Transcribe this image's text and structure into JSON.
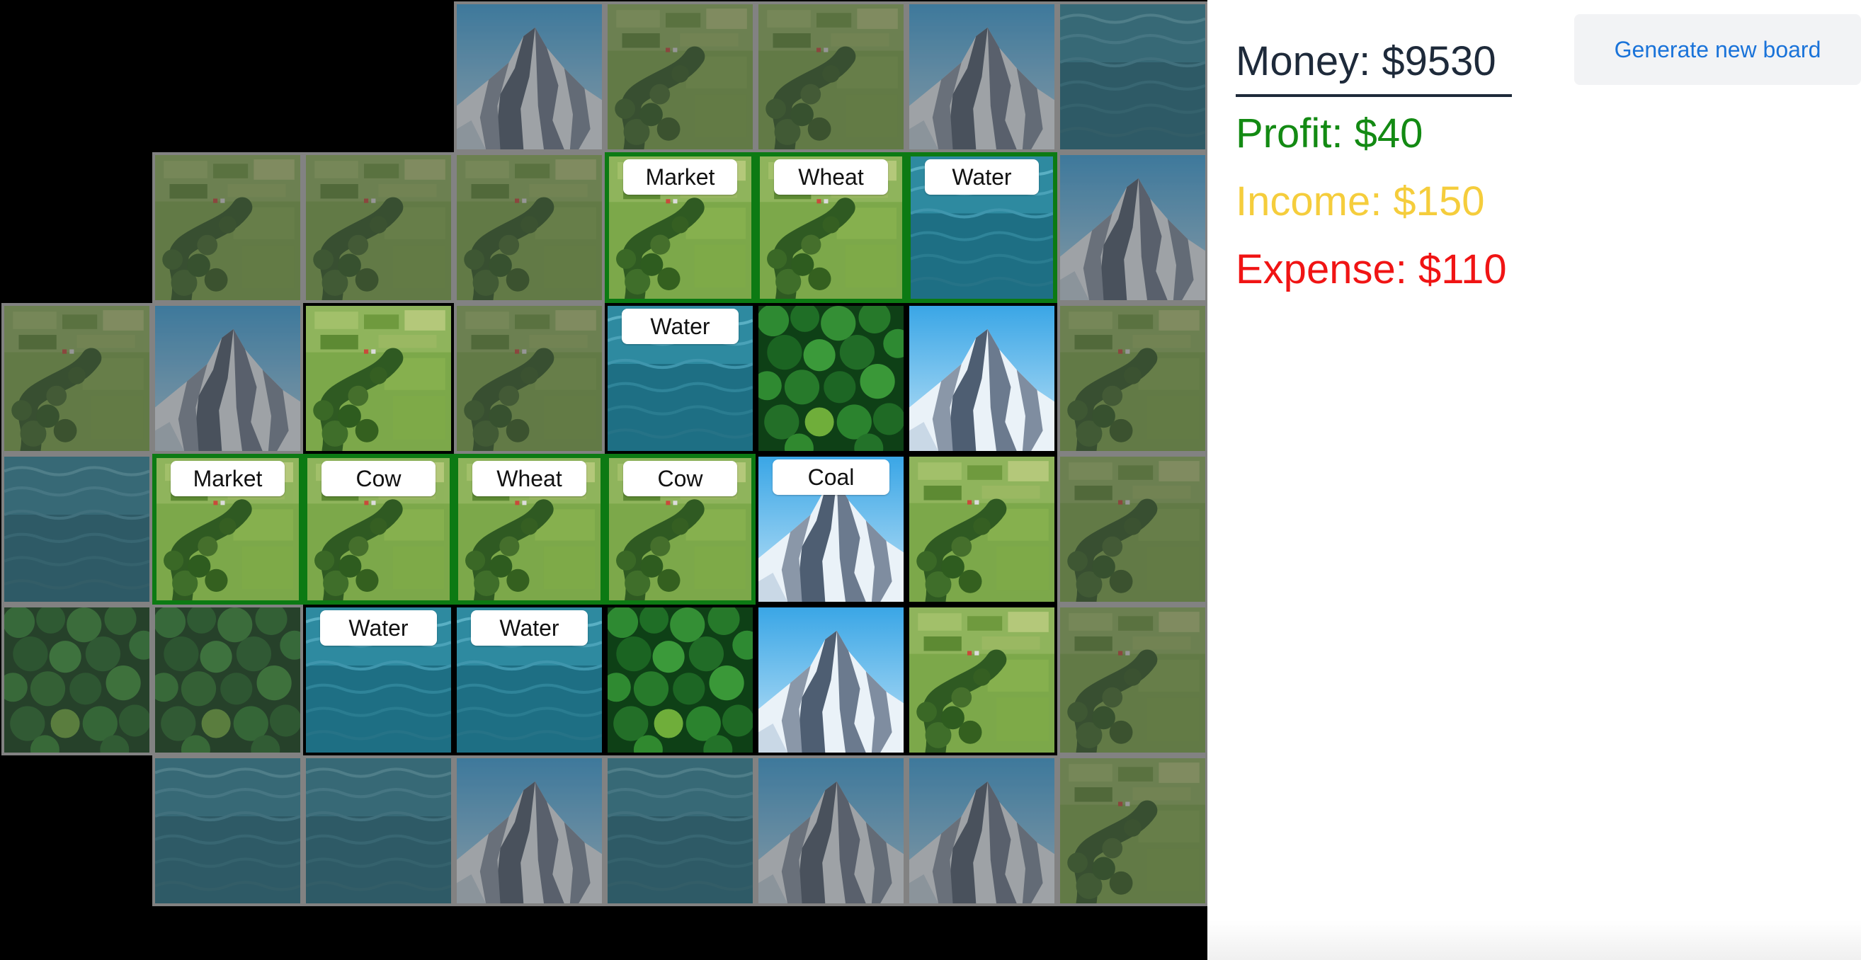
{
  "stats": {
    "money": "Money: $9530",
    "profit": "Profit: $40",
    "income": "Income: $150",
    "expense": "Expense: $110"
  },
  "button": {
    "generate_label": "Generate new board"
  },
  "colors": {
    "money": "#1e2a3a",
    "profit": "#138a13",
    "income": "#f5cd3c",
    "expense": "#f01414",
    "button_bg": "#f2f3f5",
    "button_text": "#1a73d9",
    "board_bg": "#000000",
    "grid_line": "#828282",
    "active_border": "#000000",
    "link_border": "#0c7a13"
  },
  "board": {
    "tiles": [
      [
        null,
        null,
        null,
        {
          "terrain": "mountain",
          "state": "dim"
        },
        {
          "terrain": "farm",
          "state": "dim"
        },
        {
          "terrain": "farm",
          "state": "dim"
        },
        {
          "terrain": "mountain",
          "state": "dim"
        },
        {
          "terrain": "water",
          "state": "dim"
        }
      ],
      [
        null,
        {
          "terrain": "farm",
          "state": "dim"
        },
        {
          "terrain": "farm",
          "state": "dim"
        },
        {
          "terrain": "farm",
          "state": "dim"
        },
        {
          "terrain": "farm",
          "state": "linked",
          "label": "Market"
        },
        {
          "terrain": "farm",
          "state": "linked",
          "label": "Wheat"
        },
        {
          "terrain": "water",
          "state": "linked",
          "label": "Water"
        },
        {
          "terrain": "mountain",
          "state": "dim"
        }
      ],
      [
        {
          "terrain": "farm",
          "state": "dim"
        },
        {
          "terrain": "mountain",
          "state": "dim"
        },
        {
          "terrain": "farm",
          "state": "active"
        },
        {
          "terrain": "farm",
          "state": "dim"
        },
        {
          "terrain": "water",
          "state": "active",
          "label": "Water"
        },
        {
          "terrain": "forest",
          "state": "active"
        },
        {
          "terrain": "mountain",
          "state": "active"
        },
        {
          "terrain": "farm",
          "state": "dim"
        }
      ],
      [
        {
          "terrain": "water",
          "state": "dim"
        },
        {
          "terrain": "farm",
          "state": "linked",
          "label": "Market"
        },
        {
          "terrain": "farm",
          "state": "linked",
          "label": "Cow"
        },
        {
          "terrain": "farm",
          "state": "linked",
          "label": "Wheat"
        },
        {
          "terrain": "farm",
          "state": "linked",
          "label": "Cow"
        },
        {
          "terrain": "mountain",
          "state": "active",
          "label": "Coal"
        },
        {
          "terrain": "farm",
          "state": "active"
        },
        {
          "terrain": "farm",
          "state": "dim"
        }
      ],
      [
        {
          "terrain": "forest",
          "state": "dim"
        },
        {
          "terrain": "forest",
          "state": "dim"
        },
        {
          "terrain": "water",
          "state": "active",
          "label": "Water"
        },
        {
          "terrain": "water",
          "state": "active",
          "label": "Water"
        },
        {
          "terrain": "forest",
          "state": "active"
        },
        {
          "terrain": "mountain",
          "state": "active"
        },
        {
          "terrain": "farm",
          "state": "active"
        },
        {
          "terrain": "farm",
          "state": "dim"
        }
      ],
      [
        null,
        {
          "terrain": "water",
          "state": "dim"
        },
        {
          "terrain": "water",
          "state": "dim"
        },
        {
          "terrain": "mountain",
          "state": "dim"
        },
        {
          "terrain": "water",
          "state": "dim"
        },
        {
          "terrain": "mountain",
          "state": "dim"
        },
        {
          "terrain": "mountain",
          "state": "dim"
        },
        {
          "terrain": "farm",
          "state": "dim"
        }
      ]
    ]
  }
}
